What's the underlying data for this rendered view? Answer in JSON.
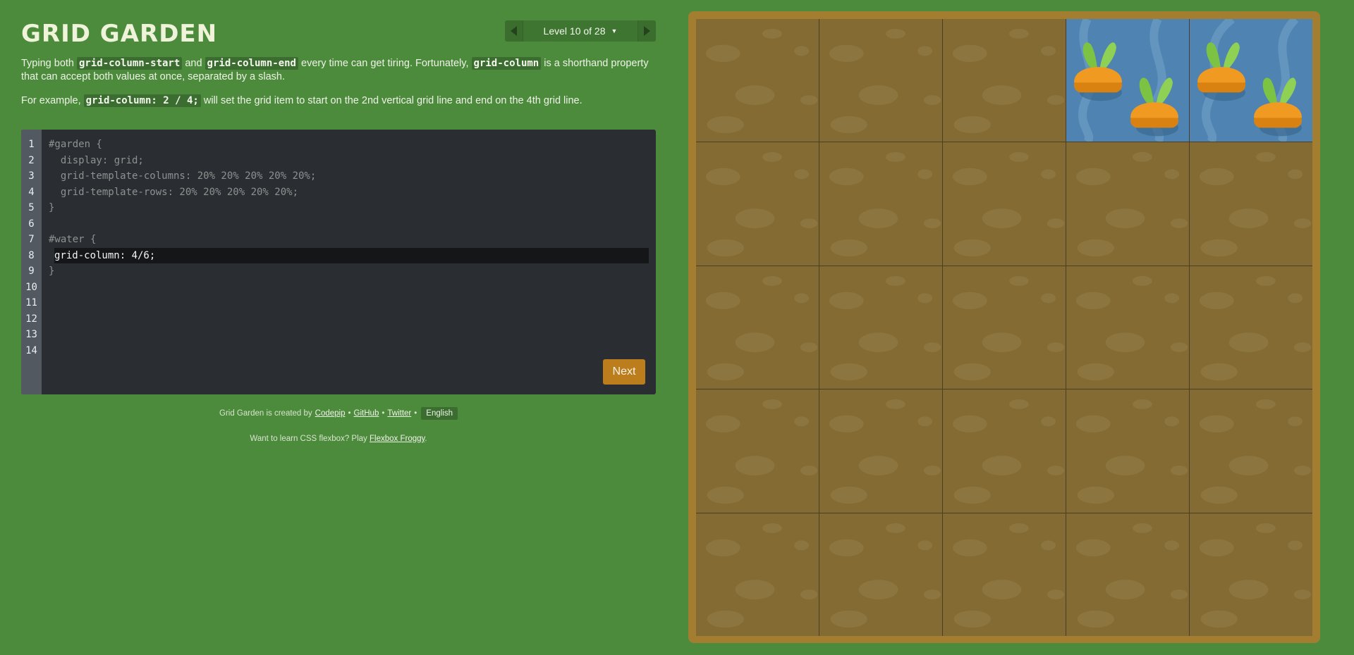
{
  "app": {
    "title": "GRID GARDEN"
  },
  "level_nav": {
    "level_label": "Level 10 of 28",
    "caret_icon": "caret-down"
  },
  "instructions": {
    "p1_a": "Typing both ",
    "p1_code1": "grid-column-start",
    "p1_b": " and ",
    "p1_code2": "grid-column-end",
    "p1_c": " every time can get tiring. Fortunately, ",
    "p1_code3": "grid-column",
    "p1_d": " is a shorthand property that can accept both values at once, separated by a slash.",
    "p2_a": "For example, ",
    "p2_code": "grid-column: 2 / 4;",
    "p2_b": " will set the grid item to start on the 2nd vertical grid line and end on the 4th grid line."
  },
  "editor": {
    "line_numbers": [
      "1",
      "2",
      "3",
      "4",
      "5",
      "6",
      "7",
      "8",
      "9",
      "10",
      "11",
      "12",
      "13",
      "14"
    ],
    "lines": [
      "#garden {",
      "  display: grid;",
      "  grid-template-columns: 20% 20% 20% 20% 20%;",
      "  grid-template-rows: 20% 20% 20% 20% 20%;",
      "}",
      "",
      "#water {",
      "grid-column: 4/6;",
      "}"
    ],
    "next_label": "Next"
  },
  "credits": {
    "prefix": "Grid Garden is created by",
    "codepip": "Codepip",
    "sep1": "•",
    "github": "GitHub",
    "sep2": "•",
    "twitter": "Twitter",
    "sep3": "•",
    "language": "English"
  },
  "froggy": {
    "prefix": "Want to learn CSS flexbox? Play ",
    "link": "Flexbox Froggy",
    "suffix": "."
  },
  "garden": {
    "rows": 5,
    "columns": 5,
    "water_column_start": 4,
    "water_column_end": 6,
    "water_row": 1,
    "colors": {
      "soil": "#846b33",
      "water": "#4f84b2",
      "frame": "#a37e31",
      "carrot": "#f09a22",
      "leaf": "#7cc243"
    }
  },
  "colors": {
    "background": "#4d8b3c",
    "editor_bg": "#2a2d31",
    "next_button": "#bc7d1d"
  }
}
